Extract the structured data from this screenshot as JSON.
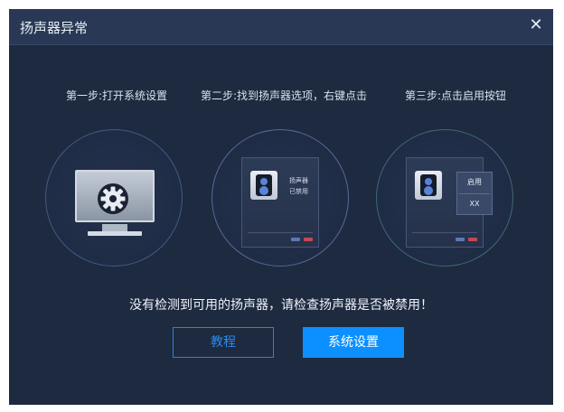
{
  "dialog": {
    "title": "扬声器异常",
    "close_glyph": "✕"
  },
  "steps": [
    {
      "label": "第一步:打开系统设置",
      "icon": "settings-gear-icon"
    },
    {
      "label": "第二步:找到扬声器选项，右键点击",
      "icon": "speaker-icon",
      "panel_text_line1": "扬声器",
      "panel_text_line2": "已禁用"
    },
    {
      "label": "第三步:点击启用按钮",
      "icon": "speaker-icon",
      "menu_items": [
        "启用",
        "XX"
      ]
    }
  ],
  "message": "没有检测到可用的扬声器，请检查扬声器是否被禁用！",
  "buttons": {
    "tutorial": "教程",
    "system_settings": "系统设置"
  },
  "colors": {
    "dialog_bg": "#1e2a3f",
    "titlebar_bg": "#293955",
    "accent": "#0c90ff",
    "outline_button": "#2b7fe2"
  }
}
